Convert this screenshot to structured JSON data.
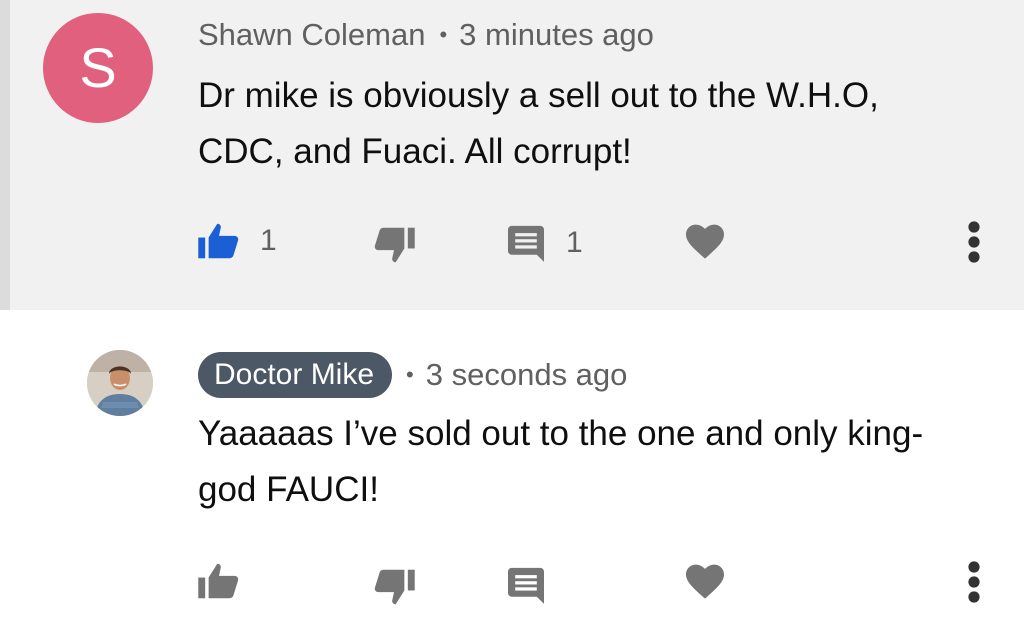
{
  "comments": [
    {
      "avatar_letter": "S",
      "avatar_color": "#e0607d",
      "author": "Shawn Coleman",
      "separator": "•",
      "time": "3 minutes ago",
      "text": "Dr mike is obviously a sell out to the W.H.O,\nCDC, and Fuaci. All corrupt!",
      "like_count": "1",
      "reply_count": "1",
      "liked": true,
      "icons": [
        "thumbs-up-icon",
        "thumbs-down-icon",
        "reply-icon",
        "heart-icon",
        "more-vertical-icon"
      ]
    },
    {
      "author": "Doctor Mike",
      "author_is_creator": true,
      "separator": "•",
      "time": "3 seconds ago",
      "text": "Yaaaaas I’ve sold out to the one and only king-\ngod FAUCI!",
      "icons": [
        "thumbs-up-icon",
        "thumbs-down-icon",
        "reply-icon",
        "heart-icon",
        "more-vertical-icon"
      ]
    }
  ],
  "colors": {
    "liked_blue": "#1a5fd4",
    "icon_gray": "#757575",
    "creator_badge": "#4d5866",
    "highlight_bg": "#f1f1f1"
  }
}
